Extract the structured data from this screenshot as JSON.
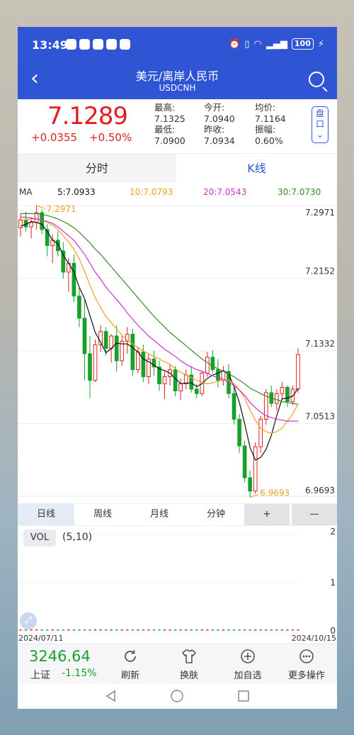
{
  "status": {
    "time": "13:49",
    "battery": "100"
  },
  "header": {
    "back_icon": "chevron-left-icon",
    "title": "美元/离岸人民币",
    "code": "USDCNH",
    "search_icon": "search-icon"
  },
  "quote": {
    "price": "7.1289",
    "change": "+0.0355",
    "change_pct": "+0.50%",
    "stats": [
      [
        "最高:",
        "今开:",
        "均价:"
      ],
      [
        "7.1325",
        "7.0940",
        "7.1164"
      ],
      [
        "最低:",
        "昨收:",
        "振幅:"
      ],
      [
        "7.0900",
        "7.0934",
        "0.60%"
      ]
    ],
    "pankou": "盘口"
  },
  "tabs": {
    "intraday": "分时",
    "kline": "K线"
  },
  "ma": {
    "label": "MA",
    "ma5": "5:7.0933",
    "ma10": "10:7.0793",
    "ma20": "20:7.0543",
    "ma30": "30:7.0730"
  },
  "colors": {
    "up": "#e02020",
    "down": "#17a02c",
    "ma5": "#111111",
    "ma10": "#f0a020",
    "ma20": "#cc33cc",
    "ma30": "#3a8a2a",
    "accent": "#2f55d4"
  },
  "chart_data": {
    "type": "candlestick",
    "y_axis_ticks": [
      "7.2971",
      "7.2152",
      "7.1332",
      "7.0513",
      "6.9693"
    ],
    "ylim": [
      6.9693,
      7.2971
    ],
    "max_label": "7.2971",
    "min_label": "6.9693",
    "x_range": [
      "2024/07/11",
      "2024/10/15"
    ],
    "ohlc": [
      [
        7.272,
        7.288,
        7.262,
        7.281
      ],
      [
        7.281,
        7.29,
        7.268,
        7.273
      ],
      [
        7.273,
        7.284,
        7.26,
        7.278
      ],
      [
        7.278,
        7.297,
        7.27,
        7.289
      ],
      [
        7.289,
        7.293,
        7.265,
        7.27
      ],
      [
        7.27,
        7.276,
        7.24,
        7.252
      ],
      [
        7.252,
        7.264,
        7.232,
        7.258
      ],
      [
        7.258,
        7.268,
        7.24,
        7.246
      ],
      [
        7.246,
        7.256,
        7.215,
        7.222
      ],
      [
        7.222,
        7.238,
        7.2,
        7.232
      ],
      [
        7.232,
        7.242,
        7.188,
        7.195
      ],
      [
        7.195,
        7.205,
        7.16,
        7.17
      ],
      [
        7.17,
        7.19,
        7.1,
        7.13
      ],
      [
        7.13,
        7.15,
        7.08,
        7.1
      ],
      [
        7.1,
        7.146,
        7.098,
        7.14
      ],
      [
        7.14,
        7.162,
        7.132,
        7.155
      ],
      [
        7.155,
        7.16,
        7.128,
        7.136
      ],
      [
        7.136,
        7.152,
        7.12,
        7.15
      ],
      [
        7.15,
        7.162,
        7.11,
        7.122
      ],
      [
        7.122,
        7.15,
        7.116,
        7.144
      ],
      [
        7.144,
        7.16,
        7.13,
        7.152
      ],
      [
        7.152,
        7.158,
        7.105,
        7.112
      ],
      [
        7.112,
        7.138,
        7.108,
        7.132
      ],
      [
        7.132,
        7.14,
        7.098,
        7.104
      ],
      [
        7.104,
        7.13,
        7.096,
        7.124
      ],
      [
        7.124,
        7.133,
        7.105,
        7.115
      ],
      [
        7.115,
        7.122,
        7.088,
        7.096
      ],
      [
        7.096,
        7.11,
        7.079,
        7.104
      ],
      [
        7.104,
        7.118,
        7.094,
        7.112
      ],
      [
        7.112,
        7.116,
        7.082,
        7.088
      ],
      [
        7.088,
        7.102,
        7.078,
        7.096
      ],
      [
        7.096,
        7.112,
        7.09,
        7.106
      ],
      [
        7.106,
        7.116,
        7.086,
        7.09
      ],
      [
        7.09,
        7.096,
        7.08,
        7.085
      ],
      [
        7.085,
        7.11,
        7.082,
        7.108
      ],
      [
        7.108,
        7.132,
        7.104,
        7.126
      ],
      [
        7.126,
        7.134,
        7.108,
        7.112
      ],
      [
        7.112,
        7.124,
        7.092,
        7.1
      ],
      [
        7.1,
        7.116,
        7.094,
        7.11
      ],
      [
        7.11,
        7.118,
        7.08,
        7.085
      ],
      [
        7.085,
        7.094,
        7.05,
        7.056
      ],
      [
        7.056,
        7.062,
        7.018,
        7.026
      ],
      [
        7.026,
        7.032,
        6.985,
        6.99
      ],
      [
        6.99,
        6.998,
        6.968,
        6.975
      ],
      [
        6.975,
        7.03,
        6.972,
        7.025
      ],
      [
        7.025,
        7.06,
        7.018,
        7.056
      ],
      [
        7.056,
        7.09,
        7.05,
        7.086
      ],
      [
        7.086,
        7.094,
        7.07,
        7.074
      ],
      [
        7.074,
        7.09,
        7.066,
        7.085
      ],
      [
        7.085,
        7.098,
        7.078,
        7.092
      ],
      [
        7.092,
        7.094,
        7.07,
        7.076
      ],
      [
        7.076,
        7.094,
        7.072,
        7.09
      ],
      [
        7.09,
        7.136,
        7.086,
        7.129
      ]
    ],
    "ma5": [
      7.274,
      7.276,
      7.279,
      7.278,
      7.276,
      7.268,
      7.258,
      7.254,
      7.241,
      7.232,
      7.222,
      7.205,
      7.192,
      7.173,
      7.154,
      7.143,
      7.131,
      7.136,
      7.142,
      7.141,
      7.141,
      7.137,
      7.132,
      7.124,
      7.121,
      7.117,
      7.113,
      7.111,
      7.108,
      7.102,
      7.096,
      7.097,
      7.097,
      7.093,
      7.096,
      7.102,
      7.106,
      7.108,
      7.111,
      7.107,
      7.093,
      7.075,
      7.051,
      7.024,
      7.01,
      7.013,
      7.022,
      7.038,
      7.06,
      7.079,
      7.08,
      7.082,
      7.091
    ],
    "ma10": [
      7.28,
      7.281,
      7.282,
      7.282,
      7.281,
      7.278,
      7.275,
      7.27,
      7.263,
      7.256,
      7.248,
      7.237,
      7.223,
      7.207,
      7.193,
      7.182,
      7.172,
      7.165,
      7.158,
      7.151,
      7.145,
      7.141,
      7.137,
      7.133,
      7.13,
      7.127,
      7.124,
      7.121,
      7.118,
      7.113,
      7.109,
      7.106,
      7.103,
      7.1,
      7.098,
      7.096,
      7.097,
      7.099,
      7.1,
      7.1,
      7.096,
      7.089,
      7.08,
      7.066,
      7.055,
      7.046,
      7.042,
      7.04,
      7.042,
      7.046,
      7.054,
      7.062,
      7.073
    ],
    "ma20": [
      7.284,
      7.284,
      7.283,
      7.282,
      7.281,
      7.279,
      7.277,
      7.273,
      7.268,
      7.263,
      7.258,
      7.25,
      7.242,
      7.232,
      7.222,
      7.214,
      7.205,
      7.198,
      7.191,
      7.184,
      7.176,
      7.169,
      7.162,
      7.156,
      7.15,
      7.145,
      7.14,
      7.135,
      7.131,
      7.127,
      7.122,
      7.118,
      7.115,
      7.112,
      7.11,
      7.108,
      7.105,
      7.103,
      7.101,
      7.098,
      7.094,
      7.089,
      7.083,
      7.075,
      7.069,
      7.064,
      7.06,
      7.058,
      7.056,
      7.055,
      7.054,
      7.054,
      7.054
    ],
    "ma30": [
      7.288,
      7.288,
      7.288,
      7.288,
      7.287,
      7.286,
      7.284,
      7.282,
      7.279,
      7.276,
      7.272,
      7.267,
      7.261,
      7.255,
      7.248,
      7.242,
      7.235,
      7.228,
      7.221,
      7.214,
      7.207,
      7.2,
      7.193,
      7.186,
      7.179,
      7.172,
      7.166,
      7.16,
      7.154,
      7.149,
      7.144,
      7.139,
      7.134,
      7.129,
      7.124,
      7.12,
      7.116,
      7.113,
      7.11,
      7.107,
      7.104,
      7.1,
      7.096,
      7.091,
      7.088,
      7.085,
      7.082,
      7.08,
      7.078,
      7.076,
      7.075,
      7.074,
      7.073
    ]
  },
  "periods": {
    "day": "日线",
    "week": "周线",
    "month": "月线",
    "minute": "分钟",
    "plus": "+",
    "minus": "—"
  },
  "volume": {
    "label": "VOL",
    "params": "(5,10)",
    "y_ticks": [
      "2",
      "1",
      "0"
    ]
  },
  "dates": {
    "start": "2024/07/11",
    "end": "2024/10/15"
  },
  "bottom": {
    "index_value": "3246.64",
    "index_name": "上证",
    "index_pct": "-1.15%",
    "buttons": [
      {
        "label": "刷新",
        "icon": "refresh-icon"
      },
      {
        "label": "换肤",
        "icon": "shirt-icon"
      },
      {
        "label": "加自选",
        "icon": "add-circle-icon"
      },
      {
        "label": "更多操作",
        "icon": "more-icon"
      }
    ]
  }
}
